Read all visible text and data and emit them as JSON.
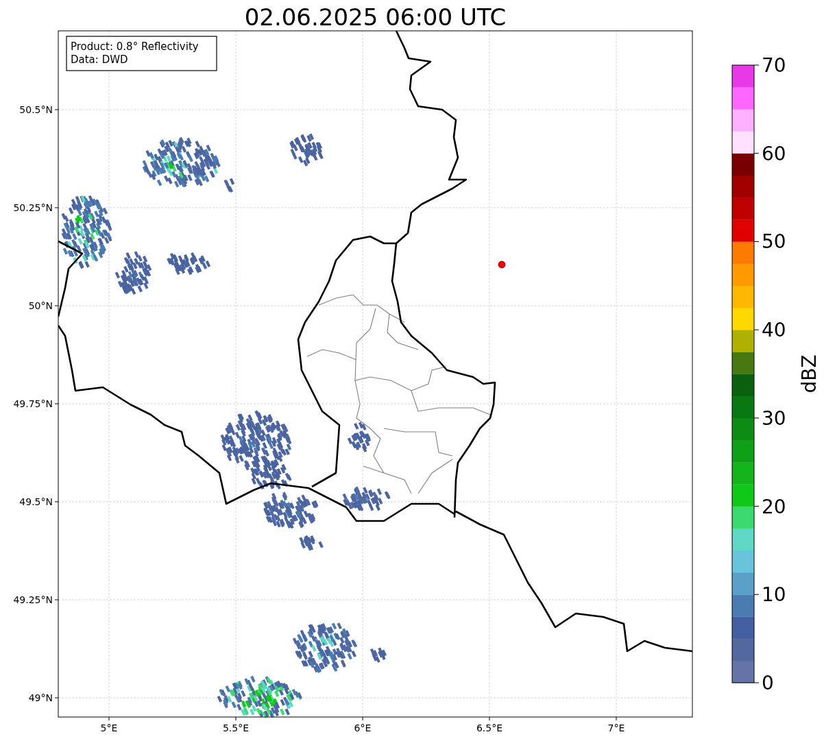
{
  "title": "02.06.2025 06:00 UTC",
  "info_box": [
    "Product: 0.8° Reflectivity",
    "Data: DWD"
  ],
  "map": {
    "lon_ticks": [
      "5°E",
      "5.5°E",
      "6°E",
      "6.5°E",
      "7°E"
    ],
    "lat_ticks": [
      "50.5°N",
      "50.25°N",
      "50°N",
      "49.75°N",
      "49.5°N",
      "49.25°N",
      "49°N"
    ],
    "marker": {
      "color": "#ff0000"
    }
  },
  "colorbar": {
    "label": "dBZ",
    "ticks": [
      "70",
      "60",
      "50",
      "40",
      "30",
      "20",
      "10",
      "0"
    ],
    "segments": [
      {
        "color": "#6474a8"
      },
      {
        "color": "#5468a0"
      },
      {
        "color": "#4560a2"
      },
      {
        "color": "#4a7cb2"
      },
      {
        "color": "#5aa0c8"
      },
      {
        "color": "#68c4dc"
      },
      {
        "color": "#5ed8c4"
      },
      {
        "color": "#3cd870"
      },
      {
        "color": "#10c818"
      },
      {
        "color": "#12b41a"
      },
      {
        "color": "#0ea016"
      },
      {
        "color": "#0c8c14"
      },
      {
        "color": "#0a7812"
      },
      {
        "color": "#0a600e"
      },
      {
        "color": "#487810"
      },
      {
        "color": "#b0b000"
      },
      {
        "color": "#ffd800"
      },
      {
        "color": "#ffb800"
      },
      {
        "color": "#ff9a00"
      },
      {
        "color": "#ff7a00"
      },
      {
        "color": "#e00000"
      },
      {
        "color": "#c00000"
      },
      {
        "color": "#a00000"
      },
      {
        "color": "#780000"
      },
      {
        "color": "#ffe0ff"
      },
      {
        "color": "#ffb0ff"
      },
      {
        "color": "#ff68ff"
      },
      {
        "color": "#e838e8"
      }
    ]
  }
}
